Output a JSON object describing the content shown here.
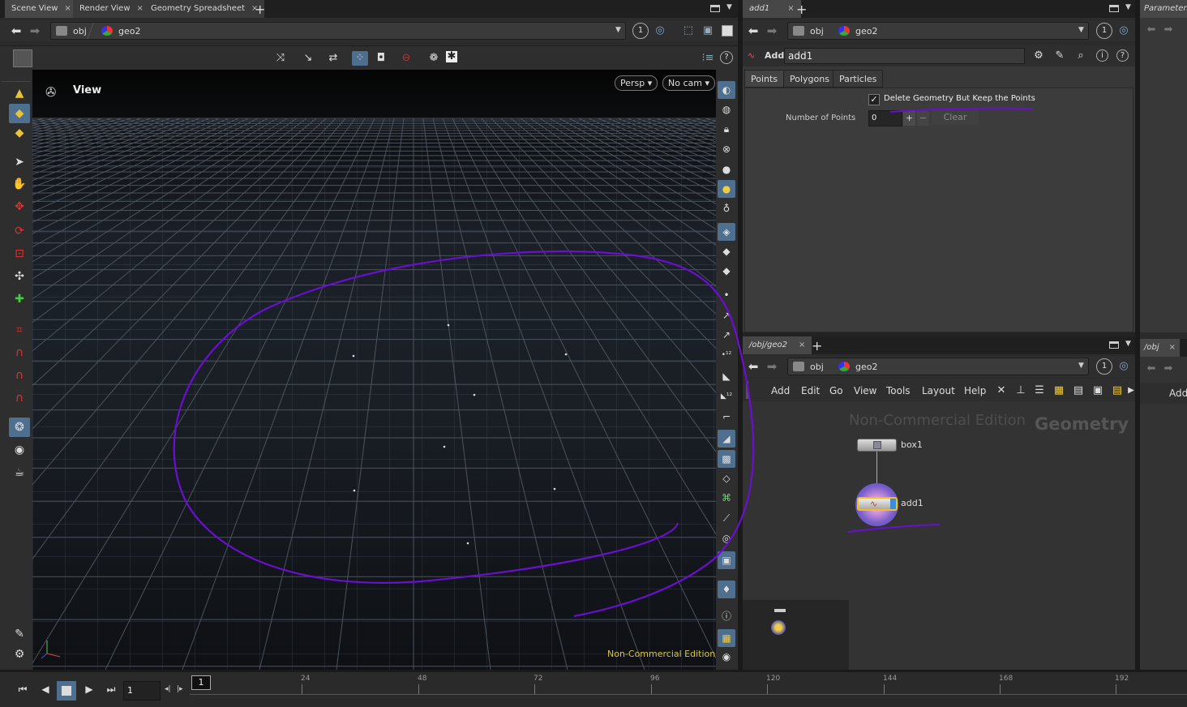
{
  "scene_panel": {
    "tabs": [
      "Scene View",
      "Render View",
      "Geometry Spreadsheet"
    ],
    "add_tab": "+",
    "path": [
      "obj",
      "geo2"
    ],
    "viewport_label": "View",
    "persp_button": "Persp",
    "cam_button": "No cam",
    "watermark": "Non-Commercial Edition",
    "link_number": "1"
  },
  "params_panel": {
    "tab": "add1",
    "add_tab": "+",
    "path": [
      "obj",
      "geo2"
    ],
    "link_number": "1",
    "node_type": "Add",
    "node_name": "add1",
    "subtabs": [
      "Points",
      "Polygons",
      "Particles"
    ],
    "checkbox_label": "Delete Geometry But Keep the Points",
    "checkbox_checked": true,
    "num_points_label": "Number of Points",
    "num_points_value": "0",
    "plus_label": "+",
    "minus_label": "−",
    "clear_label": "Clear"
  },
  "network_panel": {
    "tab": "/obj/geo2",
    "add_tab": "+",
    "path": [
      "obj",
      "geo2"
    ],
    "link_number": "1",
    "menu": [
      "Add",
      "Edit",
      "Go",
      "View",
      "Tools",
      "Layout",
      "Help"
    ],
    "watermark": "Non-Commercial Edition",
    "context_label": "Geometry",
    "nodes": [
      {
        "name": "box1"
      },
      {
        "name": "add1"
      }
    ]
  },
  "far_right": {
    "tab_top": "Parameters",
    "tab_bottom": "/obj",
    "add_label": "Add"
  },
  "timeline": {
    "frame": "1",
    "start_marker": "1",
    "ticks": [
      "24",
      "48",
      "72",
      "96",
      "120",
      "144",
      "168",
      "192"
    ]
  },
  "colors": {
    "annotation": "#6a0fd0",
    "watermark_yellow": "#d6c64a",
    "selected_node": "#f0c020"
  }
}
